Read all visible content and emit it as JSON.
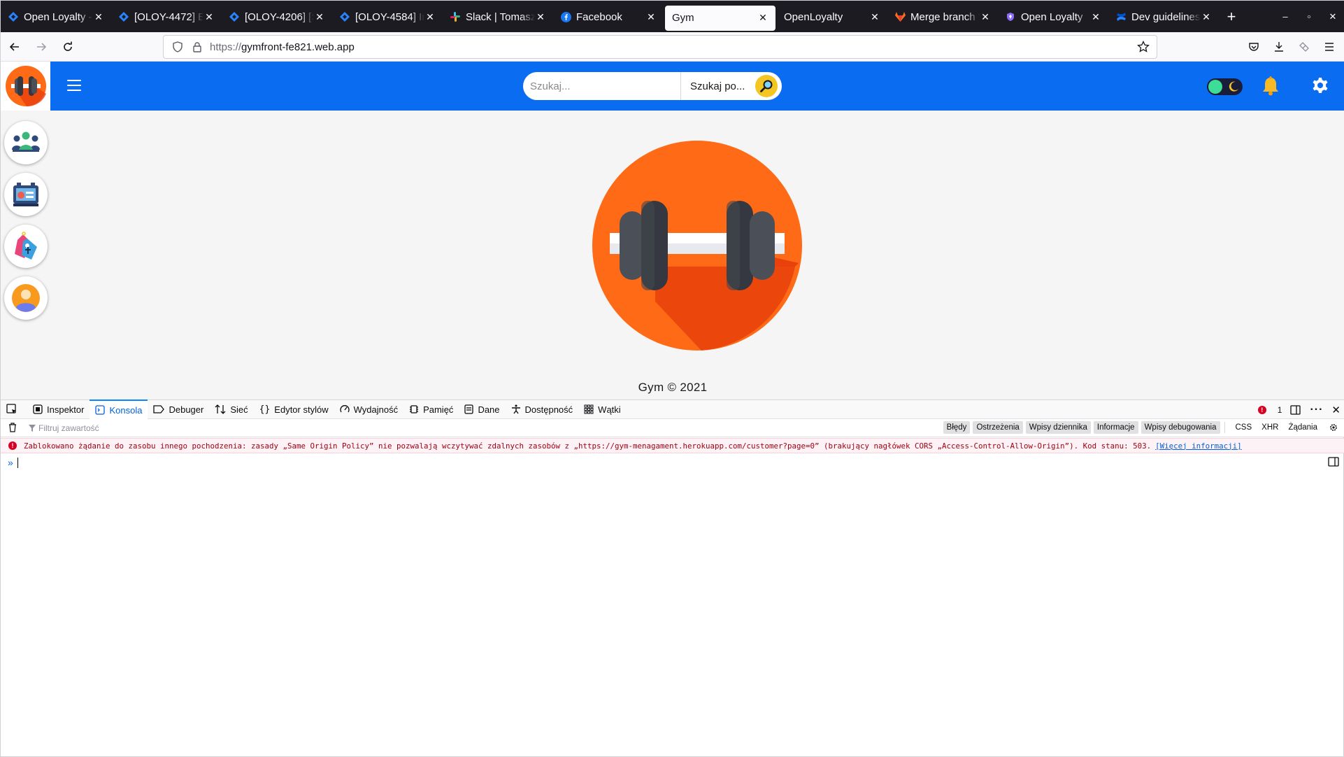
{
  "tabs": [
    {
      "label": "Open Loyalty - ",
      "icon": "jira-icon",
      "active": false
    },
    {
      "label": "[OLOY-4472] El",
      "icon": "jira-icon",
      "active": false
    },
    {
      "label": "[OLOY-4206] [S",
      "icon": "jira-icon",
      "active": false
    },
    {
      "label": "[OLOY-4584] In",
      "icon": "jira-icon",
      "active": false
    },
    {
      "label": "Slack | Tomasz",
      "icon": "slack-icon",
      "active": false
    },
    {
      "label": "Facebook",
      "icon": "facebook-icon",
      "active": false
    },
    {
      "label": "Gym",
      "icon": "none",
      "active": true
    },
    {
      "label": "OpenLoyalty",
      "icon": "none",
      "active": false
    },
    {
      "label": "Merge branch '",
      "icon": "gitlab-icon",
      "active": false
    },
    {
      "label": "Open Loyalty",
      "icon": "openloyalty-icon",
      "active": false
    },
    {
      "label": "Dev guidelines",
      "icon": "confluence-icon",
      "active": false
    }
  ],
  "browser": {
    "url_prefix": "https://",
    "url_host": "gymfront-fe821.web.app"
  },
  "header": {
    "search_placeholder": "Szukaj...",
    "search_by_label": "Szukaj po..."
  },
  "sidebar": {
    "items": [
      {
        "name": "customers",
        "icon": "people-group-icon"
      },
      {
        "name": "passes",
        "icon": "ticket-machine-icon"
      },
      {
        "name": "discounts",
        "icon": "price-tags-icon"
      },
      {
        "name": "profile",
        "icon": "user-avatar-icon"
      }
    ]
  },
  "footer": {
    "text": "Gym © 2021"
  },
  "colors": {
    "header_blue": "#0a6cf0",
    "logo_orange": "#fe6a16",
    "error_red": "#a4000f"
  },
  "devtools": {
    "tabs": [
      {
        "label": "Inspektor",
        "icon": "inspector-icon"
      },
      {
        "label": "Konsola",
        "icon": "console-icon",
        "selected": true
      },
      {
        "label": "Debuger",
        "icon": "debugger-icon"
      },
      {
        "label": "Sieć",
        "icon": "network-icon"
      },
      {
        "label": "Edytor stylów",
        "icon": "style-editor-icon"
      },
      {
        "label": "Wydajność",
        "icon": "performance-icon"
      },
      {
        "label": "Pamięć",
        "icon": "memory-icon"
      },
      {
        "label": "Dane",
        "icon": "storage-icon"
      },
      {
        "label": "Dostępność",
        "icon": "accessibility-icon"
      },
      {
        "label": "Wątki",
        "icon": "threads-icon"
      }
    ],
    "error_count": "1",
    "filter_placeholder": "Filtruj zawartość",
    "filter_buttons": [
      "Błędy",
      "Ostrzeżenia",
      "Wpisy dziennika",
      "Informacje",
      "Wpisy debugowania"
    ],
    "extra_filters": [
      "CSS",
      "XHR",
      "Żądania"
    ],
    "error_message": "Zablokowano żądanie do zasobu innego pochodzenia: zasady „Same Origin Policy” nie pozwalają wczytywać zdalnych zasobów z „https://gym-menagament.herokuapp.com/customer?page=0” (brakujący nagłówek CORS „Access-Control-Allow-Origin”). Kod stanu: 503.",
    "error_link": "[Więcej informacji]"
  }
}
